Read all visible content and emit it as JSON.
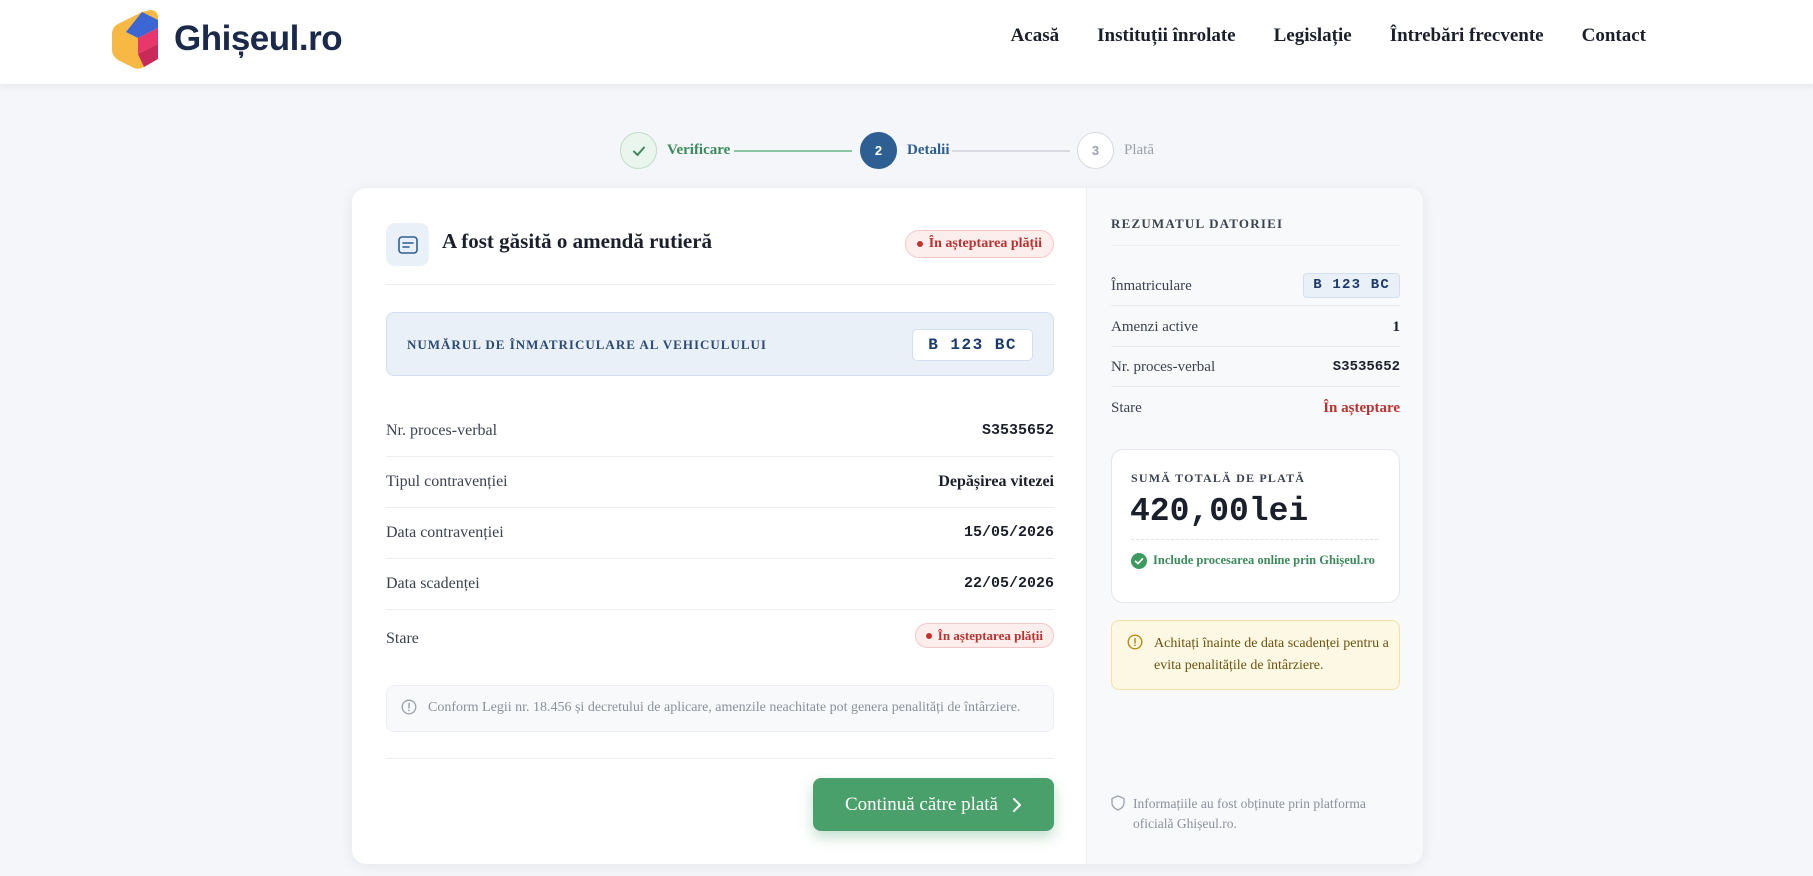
{
  "header": {
    "logo_text": "Ghișeul.ro",
    "nav": [
      "Acasă",
      "Instituții înrolate",
      "Legislație",
      "Întrebări frecvente",
      "Contact"
    ]
  },
  "stepper": {
    "steps": [
      {
        "number": "✓",
        "label": "Verificare",
        "state": "done"
      },
      {
        "number": "2",
        "label": "Detalii",
        "state": "active"
      },
      {
        "number": "3",
        "label": "Plată",
        "state": "todo"
      }
    ]
  },
  "fine": {
    "title": "A fost găsită o amendă rutieră",
    "status_badge": "În așteptarea plății",
    "plate_label": "NUMĂRUL DE ÎNMATRICULARE AL VEHICULULUI",
    "plate": "B 123 BC",
    "details": [
      {
        "label": "Nr. proces-verbal",
        "value": "S3535652"
      },
      {
        "label": "Tipul contravenției",
        "value": "Depășirea vitezei"
      },
      {
        "label": "Data contravenției",
        "value": "15/05/2026"
      },
      {
        "label": "Data scadenței",
        "value": "22/05/2026"
      },
      {
        "label": "Stare",
        "value": "În așteptarea plății"
      }
    ],
    "legal_note": "Conform Legii nr. 18.456 și decretului de aplicare, amenzile neachitate pot genera penalități de întârziere.",
    "continue_label": "Continuă către plată"
  },
  "summary": {
    "title": "REZUMATUL DATORIEI",
    "rows": [
      {
        "label": "Înmatriculare",
        "value": "B 123 BC"
      },
      {
        "label": "Amenzi active",
        "value": "1"
      },
      {
        "label": "Nr. proces-verbal",
        "value": "S3535652"
      },
      {
        "label": "Stare",
        "value": "În așteptare"
      }
    ],
    "total_label": "SUMĂ TOTALĂ DE PLATĂ",
    "total_amount": "420,00lei",
    "total_note": "Include procesarea online prin Ghișeul.ro",
    "warning": "Achitați înainte de data scadenței pentru a evita penalitățile de întârziere.",
    "source_note": "Informațiile au fost obținute prin platforma oficială Ghișeul.ro."
  },
  "colors": {
    "brand_blue": "#2d5f93",
    "success_green": "#4aa06b",
    "danger_red": "#b8322f",
    "warning_bg": "#fdf8e3"
  }
}
